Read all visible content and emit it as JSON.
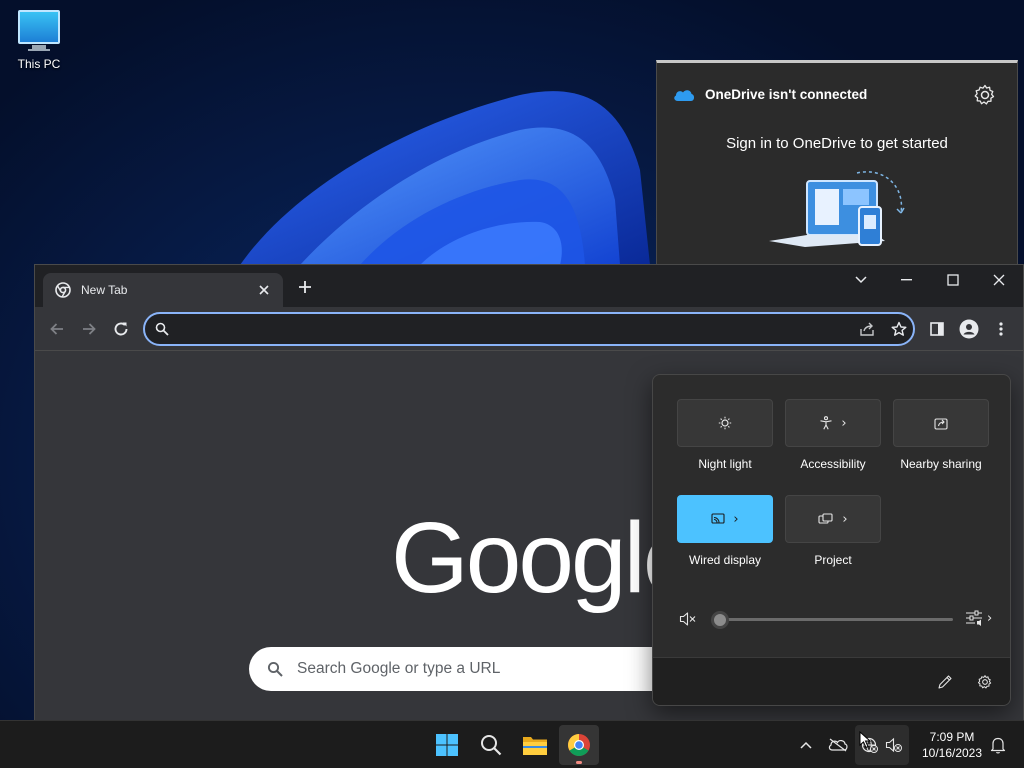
{
  "desktop": {
    "icons": [
      {
        "label": "This PC",
        "icon": "monitor-icon"
      }
    ]
  },
  "onedrive": {
    "title": "OneDrive isn't connected",
    "message": "Sign in to OneDrive to get started"
  },
  "chrome": {
    "tab_title": "New Tab",
    "address_value": "",
    "ntp_logo": "Google",
    "ntp_search_placeholder": "Search Google or type a URL",
    "theme": "dark"
  },
  "quick_settings": {
    "tiles": [
      {
        "label": "Night light",
        "icon": "night-light-icon",
        "active": false,
        "has_chevron": false
      },
      {
        "label": "Accessibility",
        "icon": "accessibility-icon",
        "active": false,
        "has_chevron": true
      },
      {
        "label": "Nearby sharing",
        "icon": "nearby-sharing-icon",
        "active": false,
        "has_chevron": false
      },
      {
        "label": "Wired display",
        "icon": "cast-icon",
        "active": true,
        "has_chevron": true
      },
      {
        "label": "Project",
        "icon": "project-icon",
        "active": false,
        "has_chevron": true
      }
    ],
    "volume": {
      "muted": true,
      "level": 0
    },
    "accent_color": "#4cc2ff"
  },
  "taskbar": {
    "apps": [
      "windows-start-icon",
      "search-icon",
      "file-explorer-icon",
      "chrome-icon"
    ],
    "active_app": "chrome-icon",
    "clock_time": "7:09 PM",
    "clock_date": "10/16/2023"
  }
}
